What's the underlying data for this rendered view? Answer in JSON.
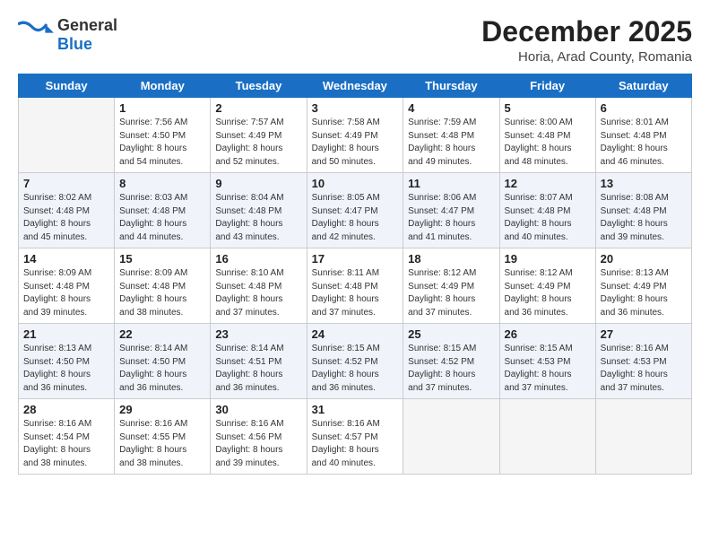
{
  "logo": {
    "text_general": "General",
    "text_blue": "Blue"
  },
  "header": {
    "month": "December 2025",
    "location": "Horia, Arad County, Romania"
  },
  "days_of_week": [
    "Sunday",
    "Monday",
    "Tuesday",
    "Wednesday",
    "Thursday",
    "Friday",
    "Saturday"
  ],
  "weeks": [
    [
      {
        "num": "",
        "info": ""
      },
      {
        "num": "1",
        "info": "Sunrise: 7:56 AM\nSunset: 4:50 PM\nDaylight: 8 hours\nand 54 minutes."
      },
      {
        "num": "2",
        "info": "Sunrise: 7:57 AM\nSunset: 4:49 PM\nDaylight: 8 hours\nand 52 minutes."
      },
      {
        "num": "3",
        "info": "Sunrise: 7:58 AM\nSunset: 4:49 PM\nDaylight: 8 hours\nand 50 minutes."
      },
      {
        "num": "4",
        "info": "Sunrise: 7:59 AM\nSunset: 4:48 PM\nDaylight: 8 hours\nand 49 minutes."
      },
      {
        "num": "5",
        "info": "Sunrise: 8:00 AM\nSunset: 4:48 PM\nDaylight: 8 hours\nand 48 minutes."
      },
      {
        "num": "6",
        "info": "Sunrise: 8:01 AM\nSunset: 4:48 PM\nDaylight: 8 hours\nand 46 minutes."
      }
    ],
    [
      {
        "num": "7",
        "info": "Sunrise: 8:02 AM\nSunset: 4:48 PM\nDaylight: 8 hours\nand 45 minutes."
      },
      {
        "num": "8",
        "info": "Sunrise: 8:03 AM\nSunset: 4:48 PM\nDaylight: 8 hours\nand 44 minutes."
      },
      {
        "num": "9",
        "info": "Sunrise: 8:04 AM\nSunset: 4:48 PM\nDaylight: 8 hours\nand 43 minutes."
      },
      {
        "num": "10",
        "info": "Sunrise: 8:05 AM\nSunset: 4:47 PM\nDaylight: 8 hours\nand 42 minutes."
      },
      {
        "num": "11",
        "info": "Sunrise: 8:06 AM\nSunset: 4:47 PM\nDaylight: 8 hours\nand 41 minutes."
      },
      {
        "num": "12",
        "info": "Sunrise: 8:07 AM\nSunset: 4:48 PM\nDaylight: 8 hours\nand 40 minutes."
      },
      {
        "num": "13",
        "info": "Sunrise: 8:08 AM\nSunset: 4:48 PM\nDaylight: 8 hours\nand 39 minutes."
      }
    ],
    [
      {
        "num": "14",
        "info": "Sunrise: 8:09 AM\nSunset: 4:48 PM\nDaylight: 8 hours\nand 39 minutes."
      },
      {
        "num": "15",
        "info": "Sunrise: 8:09 AM\nSunset: 4:48 PM\nDaylight: 8 hours\nand 38 minutes."
      },
      {
        "num": "16",
        "info": "Sunrise: 8:10 AM\nSunset: 4:48 PM\nDaylight: 8 hours\nand 37 minutes."
      },
      {
        "num": "17",
        "info": "Sunrise: 8:11 AM\nSunset: 4:48 PM\nDaylight: 8 hours\nand 37 minutes."
      },
      {
        "num": "18",
        "info": "Sunrise: 8:12 AM\nSunset: 4:49 PM\nDaylight: 8 hours\nand 37 minutes."
      },
      {
        "num": "19",
        "info": "Sunrise: 8:12 AM\nSunset: 4:49 PM\nDaylight: 8 hours\nand 36 minutes."
      },
      {
        "num": "20",
        "info": "Sunrise: 8:13 AM\nSunset: 4:49 PM\nDaylight: 8 hours\nand 36 minutes."
      }
    ],
    [
      {
        "num": "21",
        "info": "Sunrise: 8:13 AM\nSunset: 4:50 PM\nDaylight: 8 hours\nand 36 minutes."
      },
      {
        "num": "22",
        "info": "Sunrise: 8:14 AM\nSunset: 4:50 PM\nDaylight: 8 hours\nand 36 minutes."
      },
      {
        "num": "23",
        "info": "Sunrise: 8:14 AM\nSunset: 4:51 PM\nDaylight: 8 hours\nand 36 minutes."
      },
      {
        "num": "24",
        "info": "Sunrise: 8:15 AM\nSunset: 4:52 PM\nDaylight: 8 hours\nand 36 minutes."
      },
      {
        "num": "25",
        "info": "Sunrise: 8:15 AM\nSunset: 4:52 PM\nDaylight: 8 hours\nand 37 minutes."
      },
      {
        "num": "26",
        "info": "Sunrise: 8:15 AM\nSunset: 4:53 PM\nDaylight: 8 hours\nand 37 minutes."
      },
      {
        "num": "27",
        "info": "Sunrise: 8:16 AM\nSunset: 4:53 PM\nDaylight: 8 hours\nand 37 minutes."
      }
    ],
    [
      {
        "num": "28",
        "info": "Sunrise: 8:16 AM\nSunset: 4:54 PM\nDaylight: 8 hours\nand 38 minutes."
      },
      {
        "num": "29",
        "info": "Sunrise: 8:16 AM\nSunset: 4:55 PM\nDaylight: 8 hours\nand 38 minutes."
      },
      {
        "num": "30",
        "info": "Sunrise: 8:16 AM\nSunset: 4:56 PM\nDaylight: 8 hours\nand 39 minutes."
      },
      {
        "num": "31",
        "info": "Sunrise: 8:16 AM\nSunset: 4:57 PM\nDaylight: 8 hours\nand 40 minutes."
      },
      {
        "num": "",
        "info": ""
      },
      {
        "num": "",
        "info": ""
      },
      {
        "num": "",
        "info": ""
      }
    ]
  ]
}
